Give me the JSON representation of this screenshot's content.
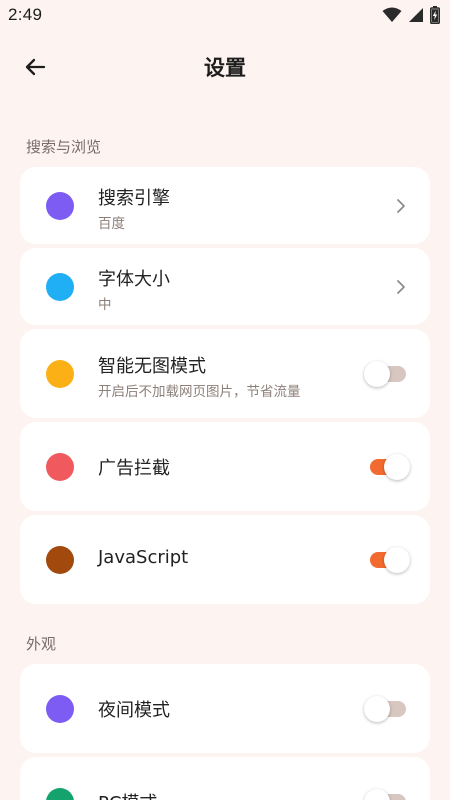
{
  "status_bar": {
    "time": "2:49",
    "icons": [
      "wifi-icon",
      "signal-icon",
      "battery-charging-icon"
    ]
  },
  "header": {
    "title": "设置",
    "back_icon": "arrow-left-icon"
  },
  "sections": [
    {
      "title": "搜索与浏览",
      "items": [
        {
          "label": "搜索引擎",
          "sublabel": "百度",
          "dot_color": "#7c5cf2",
          "control": "chevron"
        },
        {
          "label": "字体大小",
          "sublabel": "中",
          "dot_color": "#20aef5",
          "control": "chevron"
        },
        {
          "label": "智能无图模式",
          "sublabel": "开启后不加载网页图片，节省流量",
          "dot_color": "#fbb016",
          "control": "toggle",
          "on": false
        },
        {
          "label": "广告拦截",
          "dot_color": "#f05a5e",
          "control": "toggle",
          "on": true
        },
        {
          "label": "JavaScript",
          "dot_color": "#a24a0e",
          "control": "toggle",
          "on": true
        }
      ]
    },
    {
      "title": "外观",
      "items": [
        {
          "label": "夜间模式",
          "dot_color": "#7c5cf2",
          "control": "toggle",
          "on": false
        },
        {
          "label": "PC模式",
          "dot_color": "#14a36c",
          "control": "toggle",
          "on": false
        }
      ]
    }
  ],
  "colors": {
    "background": "#fdf4f1",
    "card": "#ffffff",
    "accent": "#f26a30",
    "toggle_off_track": "#d8c6c0"
  }
}
